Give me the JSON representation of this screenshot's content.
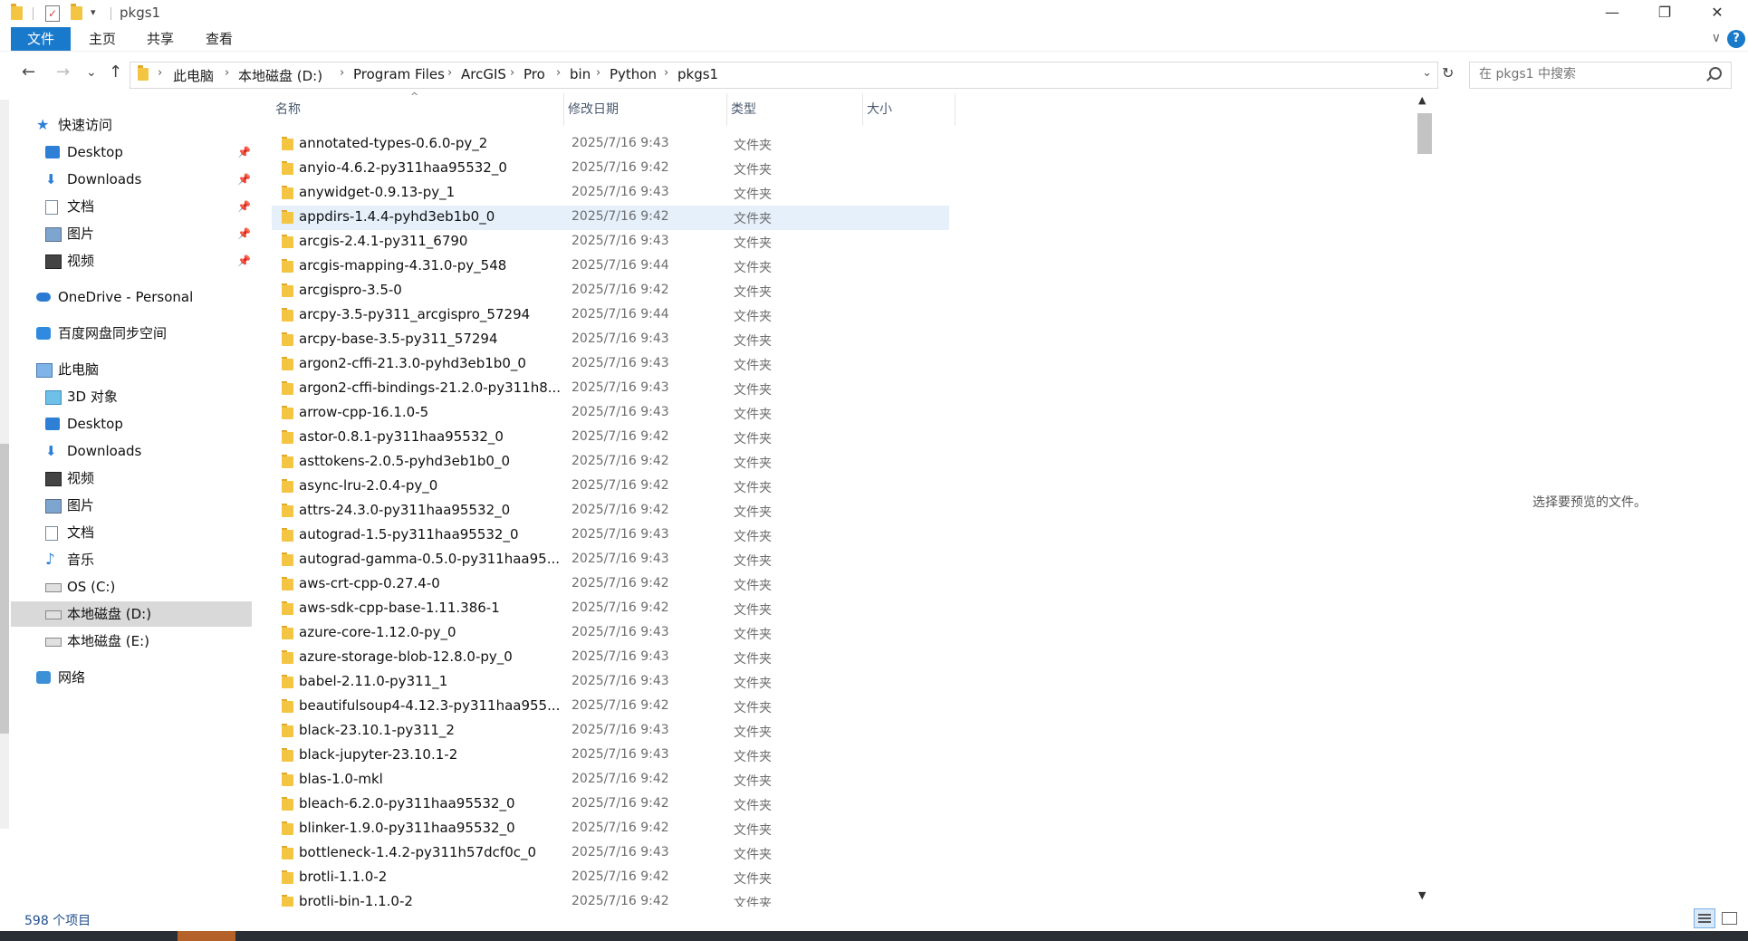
{
  "window": {
    "title": "pkgs1",
    "minimize": "—",
    "maximize": "❐",
    "close": "✕"
  },
  "ribbon": {
    "tabs": [
      "文件",
      "主页",
      "共享",
      "查看"
    ],
    "help": "?",
    "collapse": "∨"
  },
  "nav": {
    "back": "←",
    "forward": "→",
    "recent": "⌄",
    "up": "↑",
    "breadcrumbs": [
      "此电脑",
      "本地磁盘 (D:)",
      "Program Files",
      "ArcGIS",
      "Pro",
      "bin",
      "Python",
      "pkgs1"
    ],
    "separator": "›",
    "refresh": "↻",
    "dropdown": "⌄"
  },
  "search": {
    "placeholder": "在 pkgs1 中搜索"
  },
  "sidebar": {
    "quick_access": "快速访问",
    "quick_items": [
      {
        "label": "Desktop",
        "icon": "desktop-icon",
        "pinned": true
      },
      {
        "label": "Downloads",
        "icon": "downloads-icon",
        "pinned": true
      },
      {
        "label": "文档",
        "icon": "documents-icon",
        "pinned": true
      },
      {
        "label": "图片",
        "icon": "pictures-icon",
        "pinned": true
      },
      {
        "label": "视频",
        "icon": "videos-icon",
        "pinned": true
      }
    ],
    "onedrive": "OneDrive - Personal",
    "baidu": "百度网盘同步空间",
    "this_pc": "此电脑",
    "pc_items": [
      {
        "label": "3D 对象",
        "icon": "3d-objects-icon"
      },
      {
        "label": "Desktop",
        "icon": "desktop-icon"
      },
      {
        "label": "Downloads",
        "icon": "downloads-icon"
      },
      {
        "label": "视频",
        "icon": "videos-icon"
      },
      {
        "label": "图片",
        "icon": "pictures-icon"
      },
      {
        "label": "文档",
        "icon": "documents-icon"
      },
      {
        "label": "音乐",
        "icon": "music-icon"
      },
      {
        "label": "OS (C:)",
        "icon": "drive-icon"
      },
      {
        "label": "本地磁盘 (D:)",
        "icon": "drive-icon",
        "selected": true
      },
      {
        "label": "本地磁盘 (E:)",
        "icon": "drive-icon"
      }
    ],
    "network": "网络",
    "pin_glyph": "📌"
  },
  "columns": {
    "name": "名称",
    "modified": "修改日期",
    "type": "类型",
    "size": "大小",
    "sort_indicator": "^"
  },
  "files": [
    {
      "name": "annotated-types-0.6.0-py_2",
      "date": "2025/7/16 9:43",
      "type": "文件夹"
    },
    {
      "name": "anyio-4.6.2-py311haa95532_0",
      "date": "2025/7/16 9:42",
      "type": "文件夹"
    },
    {
      "name": "anywidget-0.9.13-py_1",
      "date": "2025/7/16 9:43",
      "type": "文件夹"
    },
    {
      "name": "appdirs-1.4.4-pyhd3eb1b0_0",
      "date": "2025/7/16 9:42",
      "type": "文件夹",
      "selected": true
    },
    {
      "name": "arcgis-2.4.1-py311_6790",
      "date": "2025/7/16 9:43",
      "type": "文件夹"
    },
    {
      "name": "arcgis-mapping-4.31.0-py_548",
      "date": "2025/7/16 9:44",
      "type": "文件夹"
    },
    {
      "name": "arcgispro-3.5-0",
      "date": "2025/7/16 9:42",
      "type": "文件夹"
    },
    {
      "name": "arcpy-3.5-py311_arcgispro_57294",
      "date": "2025/7/16 9:44",
      "type": "文件夹"
    },
    {
      "name": "arcpy-base-3.5-py311_57294",
      "date": "2025/7/16 9:43",
      "type": "文件夹"
    },
    {
      "name": "argon2-cffi-21.3.0-pyhd3eb1b0_0",
      "date": "2025/7/16 9:43",
      "type": "文件夹"
    },
    {
      "name": "argon2-cffi-bindings-21.2.0-py311h8...",
      "date": "2025/7/16 9:43",
      "type": "文件夹"
    },
    {
      "name": "arrow-cpp-16.1.0-5",
      "date": "2025/7/16 9:43",
      "type": "文件夹"
    },
    {
      "name": "astor-0.8.1-py311haa95532_0",
      "date": "2025/7/16 9:42",
      "type": "文件夹"
    },
    {
      "name": "asttokens-2.0.5-pyhd3eb1b0_0",
      "date": "2025/7/16 9:42",
      "type": "文件夹"
    },
    {
      "name": "async-lru-2.0.4-py_0",
      "date": "2025/7/16 9:42",
      "type": "文件夹"
    },
    {
      "name": "attrs-24.3.0-py311haa95532_0",
      "date": "2025/7/16 9:42",
      "type": "文件夹"
    },
    {
      "name": "autograd-1.5-py311haa95532_0",
      "date": "2025/7/16 9:43",
      "type": "文件夹"
    },
    {
      "name": "autograd-gamma-0.5.0-py311haa95...",
      "date": "2025/7/16 9:43",
      "type": "文件夹"
    },
    {
      "name": "aws-crt-cpp-0.27.4-0",
      "date": "2025/7/16 9:42",
      "type": "文件夹"
    },
    {
      "name": "aws-sdk-cpp-base-1.11.386-1",
      "date": "2025/7/16 9:42",
      "type": "文件夹"
    },
    {
      "name": "azure-core-1.12.0-py_0",
      "date": "2025/7/16 9:43",
      "type": "文件夹"
    },
    {
      "name": "azure-storage-blob-12.8.0-py_0",
      "date": "2025/7/16 9:43",
      "type": "文件夹"
    },
    {
      "name": "babel-2.11.0-py311_1",
      "date": "2025/7/16 9:43",
      "type": "文件夹"
    },
    {
      "name": "beautifulsoup4-4.12.3-py311haa955...",
      "date": "2025/7/16 9:42",
      "type": "文件夹"
    },
    {
      "name": "black-23.10.1-py311_2",
      "date": "2025/7/16 9:43",
      "type": "文件夹"
    },
    {
      "name": "black-jupyter-23.10.1-2",
      "date": "2025/7/16 9:43",
      "type": "文件夹"
    },
    {
      "name": "blas-1.0-mkl",
      "date": "2025/7/16 9:42",
      "type": "文件夹"
    },
    {
      "name": "bleach-6.2.0-py311haa95532_0",
      "date": "2025/7/16 9:42",
      "type": "文件夹"
    },
    {
      "name": "blinker-1.9.0-py311haa95532_0",
      "date": "2025/7/16 9:42",
      "type": "文件夹"
    },
    {
      "name": "bottleneck-1.4.2-py311h57dcf0c_0",
      "date": "2025/7/16 9:43",
      "type": "文件夹"
    },
    {
      "name": "brotli-1.1.0-2",
      "date": "2025/7/16 9:42",
      "type": "文件夹"
    },
    {
      "name": "brotli-bin-1.1.0-2",
      "date": "2025/7/16 9:42",
      "type": "文件夹"
    }
  ],
  "preview": {
    "message": "选择要预览的文件。"
  },
  "status": {
    "item_count": "598 个项目"
  }
}
